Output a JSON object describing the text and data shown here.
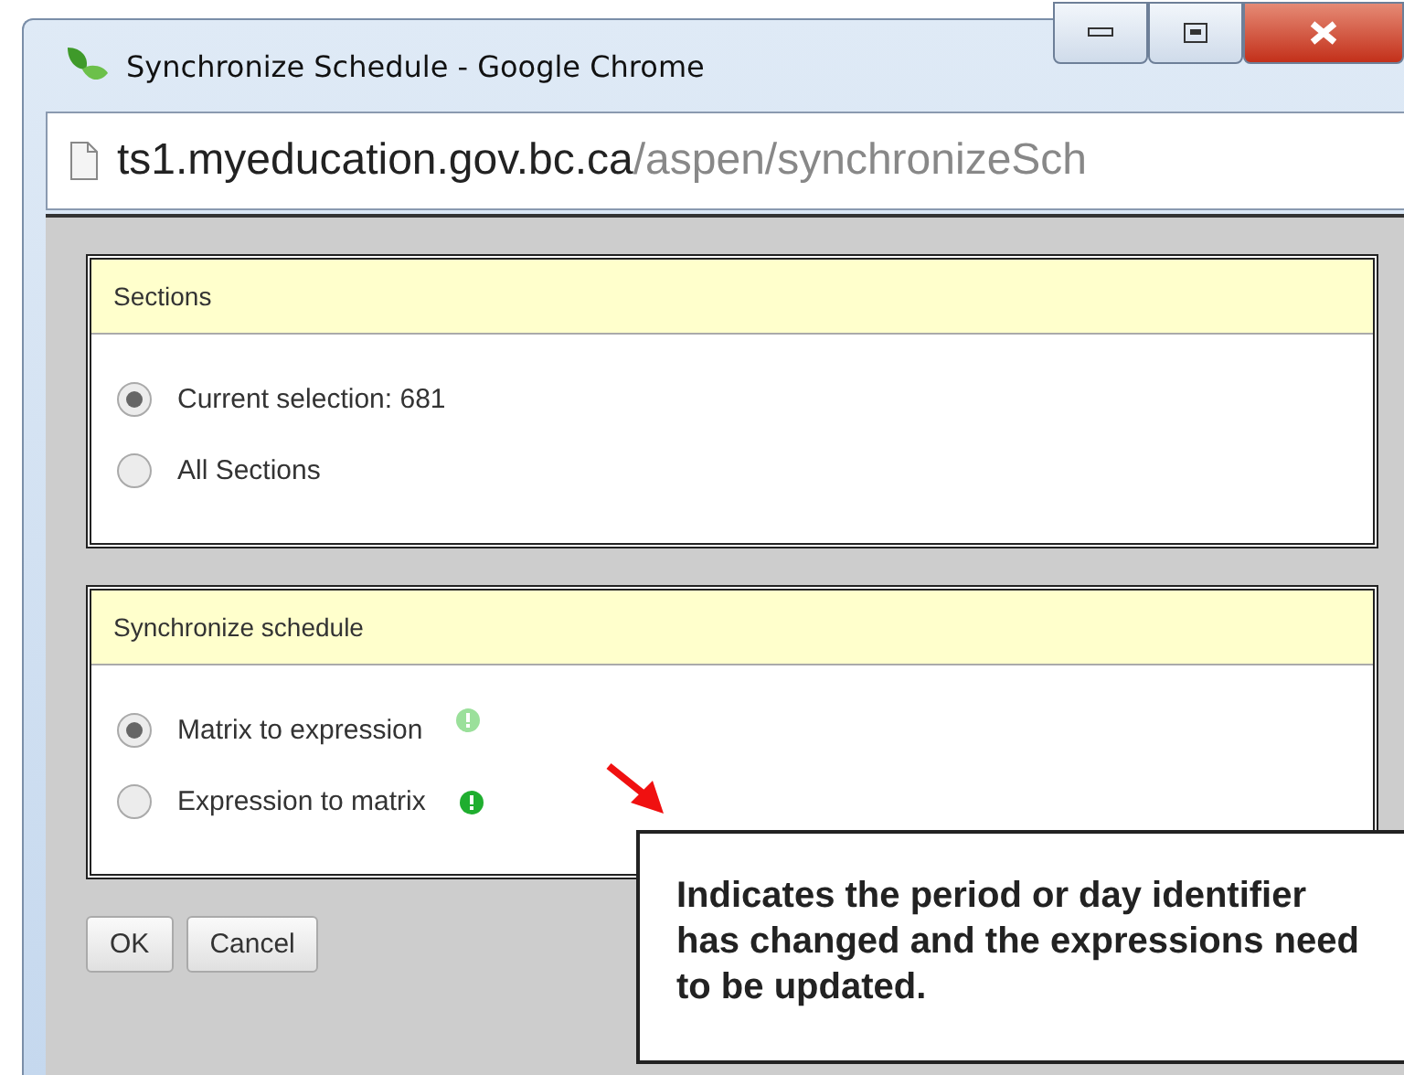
{
  "window": {
    "title": "Synchronize Schedule - Google Chrome"
  },
  "address_bar": {
    "host": "ts1.myeducation.gov.bc.ca",
    "path": "/aspen/synchronizeSch"
  },
  "panels": [
    {
      "title": "Sections",
      "options": [
        {
          "label": "Current selection: 681",
          "selected": true
        },
        {
          "label": "All Sections",
          "selected": false
        }
      ]
    },
    {
      "title": "Synchronize schedule",
      "options": [
        {
          "label": "Matrix to expression",
          "selected": true,
          "warning_emphasized": false
        },
        {
          "label": "Expression to matrix",
          "selected": false,
          "warning_emphasized": true
        }
      ]
    }
  ],
  "buttons": [
    "OK",
    "Cancel"
  ],
  "callout": {
    "text": "Indicates the period or day identifier has changed and the expressions need to be updated."
  }
}
